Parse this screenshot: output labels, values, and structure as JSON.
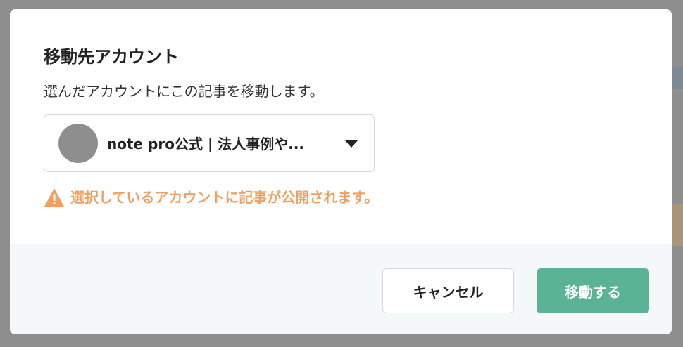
{
  "dialog": {
    "title": "移動先アカウント",
    "description": "選んだアカウントにこの記事を移動します。",
    "account_select": {
      "selected_account": "note pro公式 | 法人事例や..."
    },
    "warning": {
      "icon": "warning-triangle-icon",
      "text": "選択しているアカウントに記事が公開されます。",
      "color": "#f0a060"
    },
    "buttons": {
      "cancel_label": "キャンセル",
      "move_label": "移動する"
    }
  },
  "colors": {
    "primary": "#5ab395",
    "warning": "#f0a060",
    "overlay": "#8e8e8e"
  }
}
